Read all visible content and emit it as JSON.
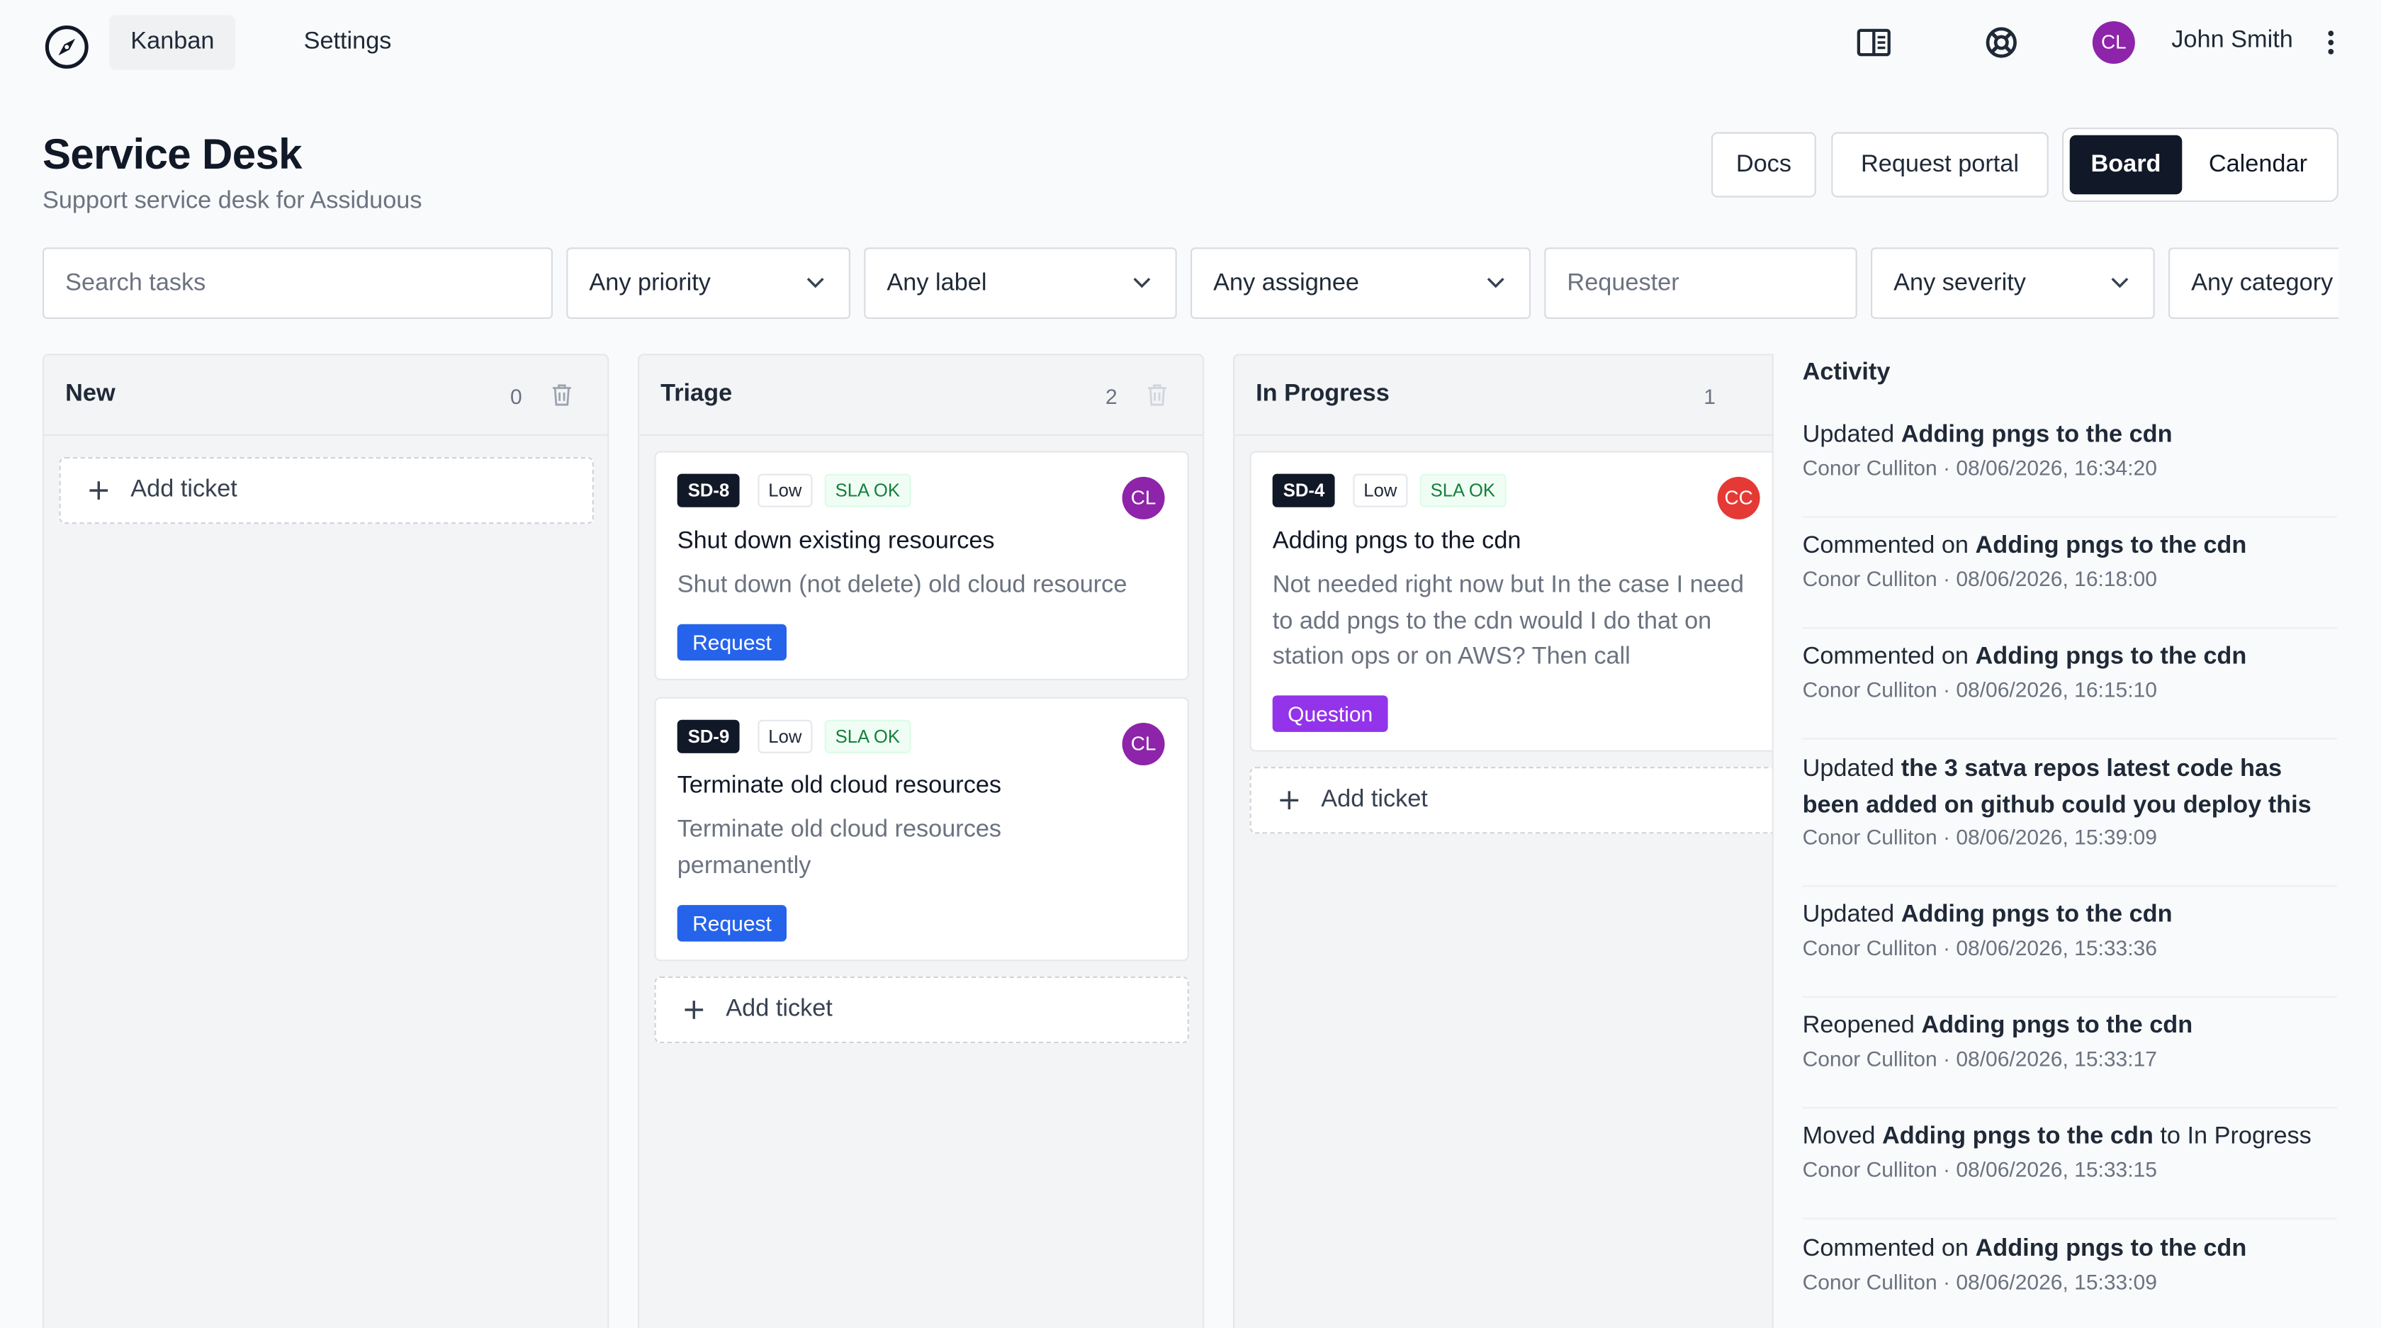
{
  "nav": {
    "tabs": [
      {
        "label": "Kanban",
        "active": true
      },
      {
        "label": "Settings",
        "active": false
      }
    ],
    "icons": [
      "compass-logo-icon",
      "sidebar-panel-icon",
      "help-lifebuoy-icon",
      "more-vertical-icon"
    ],
    "user": {
      "initials": "CL",
      "name": "John Smith",
      "avatar_color": "#8e24aa"
    }
  },
  "header": {
    "title": "Service Desk",
    "subtitle": "Support service desk for Assiduous",
    "docs_label": "Docs",
    "portal_label": "Request portal",
    "view_toggle": {
      "board": "Board",
      "calendar": "Calendar",
      "selected": "Board"
    }
  },
  "filters": {
    "search_placeholder": "Search tasks",
    "priority": "Any priority",
    "label": "Any label",
    "assignee": "Any assignee",
    "requester_placeholder": "Requester",
    "severity": "Any severity",
    "category": "Any category"
  },
  "columns": [
    {
      "title": "New",
      "count": "0",
      "add_label": "Add ticket",
      "cards": []
    },
    {
      "title": "Triage",
      "count": "2",
      "add_label": "Add ticket",
      "cards": [
        {
          "id": "SD-8",
          "priority": "Low",
          "sla": "SLA OK",
          "assignee_initials": "CL",
          "title": "Shut down existing resources",
          "description": "Shut down (not delete) old cloud resource",
          "category": "Request"
        },
        {
          "id": "SD-9",
          "priority": "Low",
          "sla": "SLA OK",
          "assignee_initials": "CL",
          "title": "Terminate old cloud resources",
          "description": "Terminate old cloud resources permanently",
          "category": "Request"
        }
      ]
    },
    {
      "title": "In Progress",
      "count": "1",
      "add_label": "Add ticket",
      "cards": [
        {
          "id": "SD-4",
          "priority": "Low",
          "sla": "SLA OK",
          "assignee_initials": "CC",
          "title": "Adding pngs to the cdn",
          "description": "Not needed right now but In the case I need to add pngs to the cdn would I do that on station ops or on AWS? Then call",
          "category": "Question"
        }
      ]
    }
  ],
  "activity": {
    "title": "Activity",
    "items": [
      {
        "action": "Updated",
        "subject": "Adding pngs to the cdn",
        "suffix": "",
        "meta": "Conor Culliton · 08/06/2026, 16:34:20"
      },
      {
        "action": "Commented on",
        "subject": "Adding pngs to the cdn",
        "suffix": "",
        "meta": "Conor Culliton · 08/06/2026, 16:18:00"
      },
      {
        "action": "Commented on",
        "subject": "Adding pngs to the cdn",
        "suffix": "",
        "meta": "Conor Culliton · 08/06/2026, 16:15:10"
      },
      {
        "action": "Updated",
        "subject": "the 3 satva repos latest code has been added on github could you deploy this",
        "suffix": "",
        "meta": "Conor Culliton · 08/06/2026, 15:39:09"
      },
      {
        "action": "Updated",
        "subject": "Adding pngs to the cdn",
        "suffix": "",
        "meta": "Conor Culliton · 08/06/2026, 15:33:36"
      },
      {
        "action": "Reopened",
        "subject": "Adding pngs to the cdn",
        "suffix": "",
        "meta": "Conor Culliton · 08/06/2026, 15:33:17"
      },
      {
        "action": "Moved",
        "subject": "Adding pngs to the cdn",
        "suffix": "to In Progress",
        "meta": "Conor Culliton · 08/06/2026, 15:33:15"
      },
      {
        "action": "Commented on",
        "subject": "Adding pngs to the cdn",
        "suffix": "",
        "meta": "Conor Culliton · 08/06/2026, 15:33:09"
      }
    ]
  },
  "colors": {
    "accent_dark": "#111827",
    "request_blue": "#2563eb",
    "question_purple": "#9333ea",
    "sla_green": "#15803d",
    "assignee_red": "#e53935"
  }
}
